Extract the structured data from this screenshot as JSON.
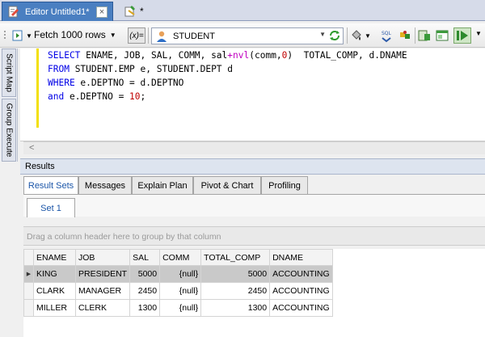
{
  "tabs": {
    "editor_label": "Editor Untitled1*",
    "close_glyph": "×",
    "new_tab_label": "*"
  },
  "toolbar": {
    "fetch_label": "Fetch 1000 rows",
    "var_label": "(x)=",
    "connection": "STUDENT"
  },
  "side_tabs": {
    "script_map": "Script Map",
    "group_execute": "Group Execute"
  },
  "editor": {
    "lines": [
      [
        {
          "t": "SELECT",
          "c": "kw"
        },
        {
          "t": " ENAME, JOB, SAL, COMM, sal",
          "c": ""
        },
        {
          "t": "+",
          "c": "fn"
        },
        {
          "t": "nvl",
          "c": "fn"
        },
        {
          "t": "(comm,",
          "c": ""
        },
        {
          "t": "0",
          "c": "num"
        },
        {
          "t": ")  TOTAL_COMP, d.DNAME",
          "c": ""
        }
      ],
      [
        {
          "t": "FROM",
          "c": "kw"
        },
        {
          "t": " STUDENT.EMP e, STUDENT.DEPT d",
          "c": ""
        }
      ],
      [
        {
          "t": "WHERE",
          "c": "kw"
        },
        {
          "t": " e.DEPTNO = d.DEPTNO",
          "c": ""
        }
      ],
      [
        {
          "t": "and",
          "c": "kw"
        },
        {
          "t": " e.DEPTNO = ",
          "c": ""
        },
        {
          "t": "10",
          "c": "num"
        },
        {
          "t": ";",
          "c": ""
        }
      ]
    ]
  },
  "results": {
    "title": "Results",
    "tabs": [
      "Result Sets",
      "Messages",
      "Explain Plan",
      "Pivot & Chart",
      "Profiling"
    ],
    "active_tab": "Result Sets",
    "set_tab": "Set 1",
    "group_hint": "Drag a column header here to group by that column",
    "columns": [
      "ENAME",
      "JOB",
      "SAL",
      "COMM",
      "TOTAL_COMP",
      "DNAME"
    ],
    "rows": [
      [
        "KING",
        "PRESIDENT",
        "5000",
        "{null}",
        "5000",
        "ACCOUNTING"
      ],
      [
        "CLARK",
        "MANAGER",
        "2450",
        "{null}",
        "2450",
        "ACCOUNTING"
      ],
      [
        "MILLER",
        "CLERK",
        "1300",
        "{null}",
        "1300",
        "ACCOUNTING"
      ]
    ],
    "selected_row": 0
  },
  "icons": [
    "editor-document-icon",
    "new-tab-icon",
    "execute-menu-icon",
    "variables-icon",
    "user-connection-icon",
    "refresh-icon",
    "paint-bucket-icon",
    "sql-format-icon",
    "puzzle-icon",
    "export-icon",
    "window-icon",
    "run-script-icon"
  ]
}
